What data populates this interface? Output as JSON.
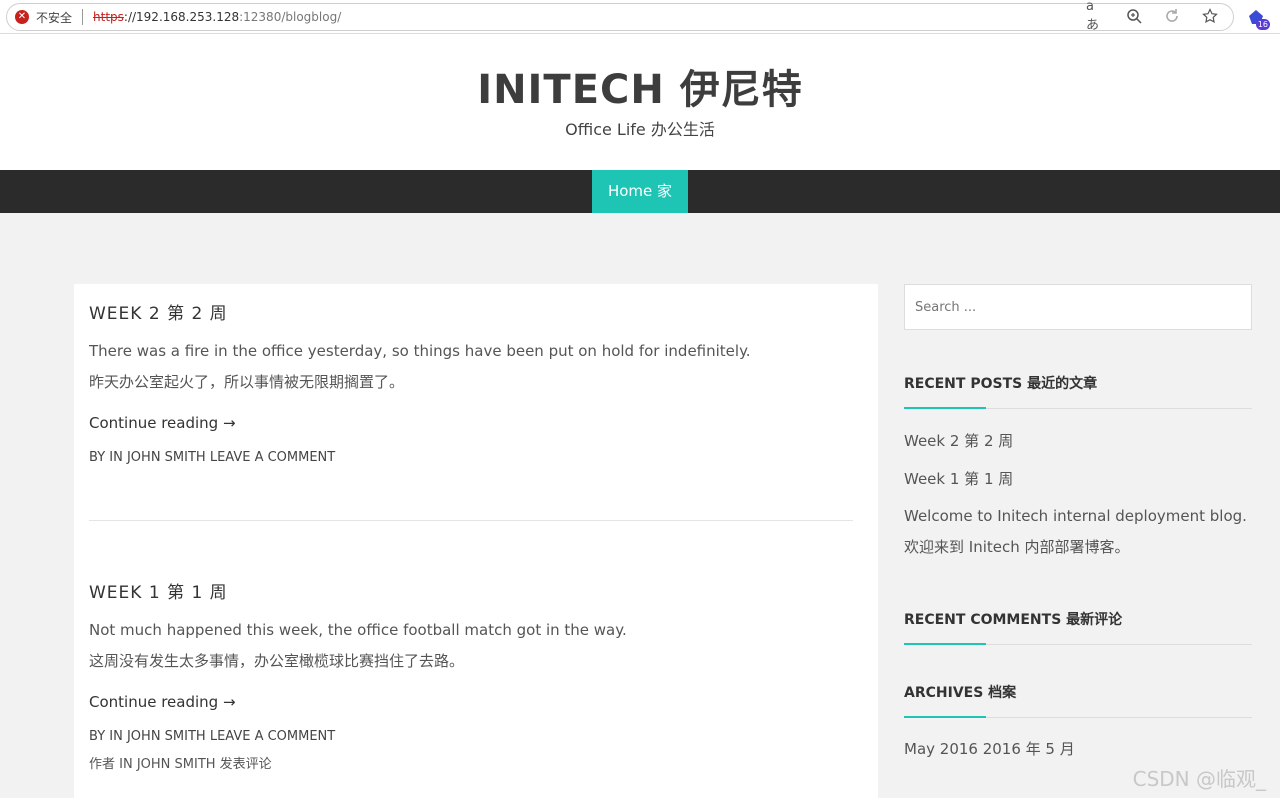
{
  "browser": {
    "insecure_label": "不安全",
    "url_scheme": "https",
    "url_host": "://192.168.253.128",
    "url_rest": ":12380/blogblog/",
    "extension_badge": "16"
  },
  "header": {
    "title": "INITECH  伊尼特",
    "tagline": "Office Life  办公生活"
  },
  "nav": {
    "home_label": "Home  家"
  },
  "posts": [
    {
      "title": "WEEK 2  第 2 周",
      "excerpt_en": "There was a fire in the office yesterday, so things have been put on hold for indefinitely.",
      "excerpt_cn": "昨天办公室起火了，所以事情被无限期搁置了。",
      "continue": "Continue reading →",
      "meta": "BY IN JOHN SMITH LEAVE A COMMENT"
    },
    {
      "title": "WEEK 1  第 1 周",
      "excerpt_en": "Not much happened this week, the office football match got in the way.",
      "excerpt_cn": "这周没有发生太多事情，办公室橄榄球比赛挡住了去路。",
      "continue": "Continue reading →",
      "meta": "BY IN JOHN SMITH LEAVE A COMMENT",
      "meta_cn": "作者 IN JOHN SMITH 发表评论"
    }
  ],
  "sidebar": {
    "search_placeholder": "Search ...",
    "recent_posts_title": "RECENT POSTS  最近的文章",
    "recent_posts": [
      "Week 2  第 2 周",
      "Week 1  第 1 周",
      "Welcome to Initech internal deployment blog.",
      "欢迎来到 Initech 内部部署博客。"
    ],
    "recent_comments_title": "RECENT COMMENTS  最新评论",
    "archives_title": "ARCHIVES  档案",
    "archives": [
      "May 2016  2016 年 5 月"
    ]
  },
  "watermark": "CSDN @临观_"
}
